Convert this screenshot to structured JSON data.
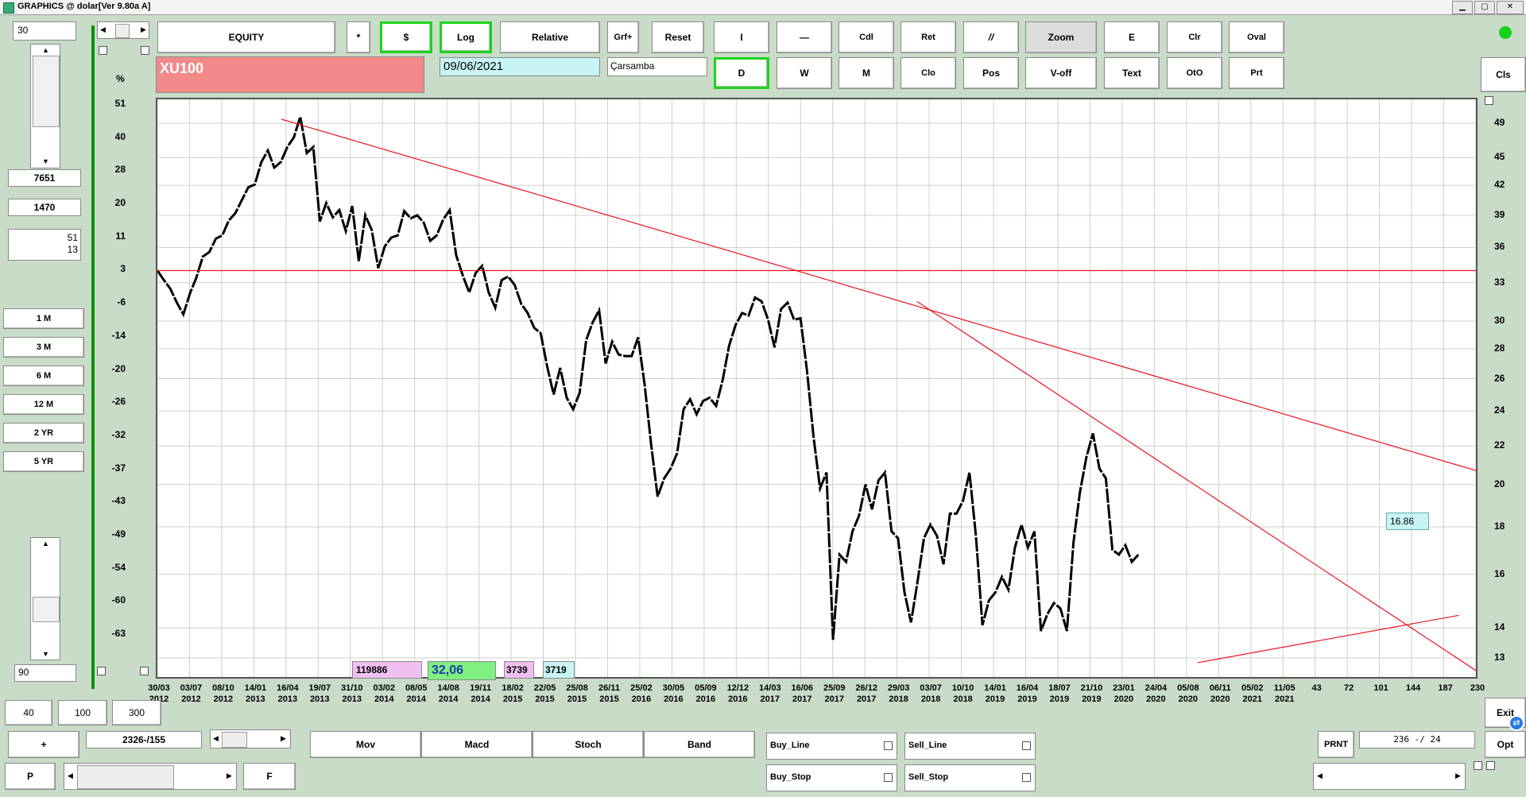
{
  "window": {
    "title": "GRAPHICS  @ dolar[Ver 9.80a A]"
  },
  "left_panel": {
    "top_input": "30",
    "val1": "7651",
    "val2": "1470",
    "val3a": "51",
    "val3b": "13",
    "periods": [
      "1 M",
      "3 M",
      "6 M",
      "12 M",
      "2 YR",
      "5 YR"
    ],
    "bottom_input": "90"
  },
  "toolbar": {
    "equity": "EQUITY",
    "star": "*",
    "dollar": "$",
    "log": "Log",
    "relative": "Relative",
    "grf": "Grf+",
    "reset": "Reset",
    "i": "I",
    "dash": "—",
    "cdl": "Cdl",
    "ret": "Ret",
    "parallel": "//",
    "zoom": "Zoom",
    "e": "E",
    "clr": "Clr",
    "oval": "Oval",
    "d": "D",
    "w": "W",
    "m": "M",
    "clo": "Clo",
    "pos": "Pos",
    "voff": "V-off",
    "text": "Text",
    "oto": "OtO",
    "prt": "Prt",
    "cls": "Cls"
  },
  "info": {
    "symbol": "XU100",
    "date": "09/06/2021",
    "weekday": "Çarsamba"
  },
  "chart_data": {
    "type": "line",
    "ylabel_left": "%",
    "y_left_ticks": [
      "51",
      "40",
      "28",
      "20",
      "11",
      "3",
      "-6",
      "-14",
      "-20",
      "-26",
      "-32",
      "-37",
      "-43",
      "-49",
      "-54",
      "-60",
      "-63"
    ],
    "y_right_ticks": [
      "49",
      "45",
      "42",
      "39",
      "36",
      "33",
      "30",
      "28",
      "26",
      "24",
      "22",
      "20",
      "18",
      "16",
      "14",
      "13"
    ],
    "x_ticks": [
      [
        "30/03",
        "2012"
      ],
      [
        "03/07",
        "2012"
      ],
      [
        "08/10",
        "2012"
      ],
      [
        "14/01",
        "2013"
      ],
      [
        "16/04",
        "2013"
      ],
      [
        "19/07",
        "2013"
      ],
      [
        "31/10",
        "2013"
      ],
      [
        "03/02",
        "2014"
      ],
      [
        "08/05",
        "2014"
      ],
      [
        "14/08",
        "2014"
      ],
      [
        "19/11",
        "2014"
      ],
      [
        "18/02",
        "2015"
      ],
      [
        "22/05",
        "2015"
      ],
      [
        "25/08",
        "2015"
      ],
      [
        "26/11",
        "2015"
      ],
      [
        "25/02",
        "2016"
      ],
      [
        "30/05",
        "2016"
      ],
      [
        "05/09",
        "2016"
      ],
      [
        "12/12",
        "2016"
      ],
      [
        "14/03",
        "2017"
      ],
      [
        "16/06",
        "2017"
      ],
      [
        "25/09",
        "2017"
      ],
      [
        "26/12",
        "2017"
      ],
      [
        "29/03",
        "2018"
      ],
      [
        "03/07",
        "2018"
      ],
      [
        "10/10",
        "2018"
      ],
      [
        "14/01",
        "2019"
      ],
      [
        "16/04",
        "2019"
      ],
      [
        "18/07",
        "2019"
      ],
      [
        "21/10",
        "2019"
      ],
      [
        "23/01",
        "2020"
      ],
      [
        "24/04",
        "2020"
      ],
      [
        "05/08",
        "2020"
      ],
      [
        "06/11",
        "2020"
      ],
      [
        "05/02",
        "2021"
      ],
      [
        "11/05",
        "2021"
      ],
      [
        "43",
        ""
      ],
      [
        "72",
        ""
      ],
      [
        "101",
        ""
      ],
      [
        "144",
        ""
      ],
      [
        "187",
        ""
      ],
      [
        "230",
        ""
      ]
    ],
    "series": [
      {
        "values": [
          34,
          33.2,
          32.5,
          31.4,
          30.5,
          32.1,
          33.4,
          35.2,
          35.6,
          36.8,
          37.1,
          38.5,
          39.2,
          40.5,
          41.8,
          42.1,
          44.5,
          45.8,
          43.9,
          44.5,
          46.2,
          47.3,
          49.8,
          45.5,
          46.2,
          38.4,
          40.2,
          38.8,
          39.5,
          37.5,
          39.9,
          34.8,
          39.0,
          37.6,
          34.2,
          36.1,
          36.9,
          37.1,
          39.4,
          38.7,
          39.0,
          38.3,
          36.6,
          37.1,
          38.6,
          39.5,
          35.3,
          33.6,
          32.2,
          33.8,
          34.4,
          32.2,
          31.0,
          33.2,
          33.5,
          32.8,
          31.3,
          30.6,
          29.5,
          29.1,
          26.8,
          25.0,
          26.7,
          24.8,
          24.1,
          25.1,
          28.6,
          29.9,
          30.8,
          27.0,
          28.5,
          27.6,
          27.5,
          27.5,
          28.8,
          25.6,
          22.1,
          19.4,
          20.3,
          20.8,
          21.6,
          24.1,
          24.7,
          23.8,
          24.6,
          24.8,
          24.3,
          25.9,
          28.2,
          29.7,
          30.6,
          30.4,
          31.8,
          31.5,
          30.1,
          28.1,
          30.9,
          31.4,
          30.1,
          30.2,
          26.5,
          22.5,
          19.8,
          20.6,
          13.6,
          16.8,
          16.5,
          17.8,
          18.5,
          20.0,
          18.8,
          20.2,
          20.6,
          17.8,
          17.5,
          15.3,
          14.2,
          15.7,
          17.5,
          18.1,
          17.6,
          16.4,
          18.6,
          18.6,
          19.2,
          20.6,
          17.6,
          14.1,
          15.0,
          15.3,
          15.9,
          15.4,
          17.1,
          18.1,
          17.1,
          17.8,
          13.9,
          14.5,
          14.9,
          14.7,
          13.9,
          17.3,
          19.6,
          21.4,
          22.7,
          20.8,
          20.3,
          17.0,
          16.8,
          17.2,
          16.5,
          16.8
        ]
      }
    ],
    "last_value": "16.86"
  },
  "bottom_panel": {
    "chip1": "119886",
    "chip2": "32,06",
    "chip3": "3739",
    "chip4": "3719",
    "b40": "40",
    "b100": "100",
    "b300": "300",
    "plus": "+",
    "counter": "2326-/155",
    "p": "P",
    "f": "F",
    "mov": "Mov",
    "macd": "Macd",
    "stoch": "Stoch",
    "band": "Band",
    "buy_line": "Buy_Line",
    "sell_line": "Sell_Line",
    "buy_stop": "Buy_Stop",
    "sell_stop": "Sell_Stop",
    "prnt": "PRNT",
    "pos_readout": "236 -/ 24",
    "exit": "Exit",
    "opt": "Opt"
  },
  "colors": {
    "trendline": "#e8141e",
    "series": "#000000",
    "accent": "#1cd41c",
    "symbol_bg": "#f28a8a"
  }
}
